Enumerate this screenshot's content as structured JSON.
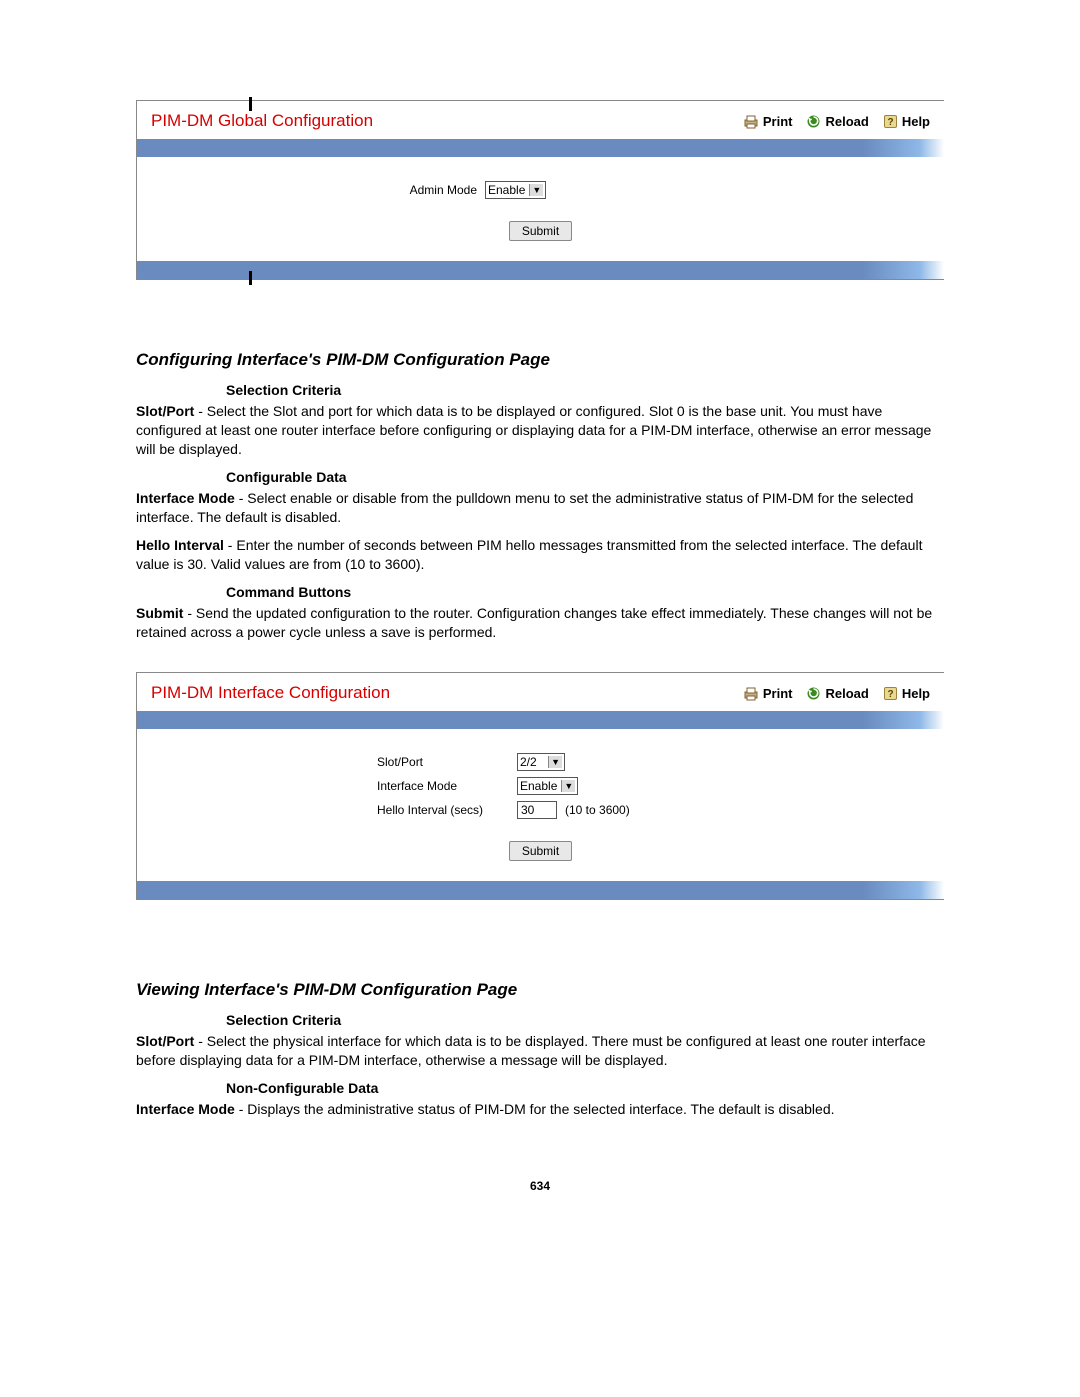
{
  "panel1": {
    "title": "PIM-DM Global Configuration",
    "actions": {
      "print": "Print",
      "reload": "Reload",
      "help": "Help"
    },
    "form": {
      "admin_mode_label": "Admin Mode",
      "admin_mode_value": "Enable"
    },
    "submit": "Submit"
  },
  "section1": {
    "heading": "Configuring Interface's PIM-DM Configuration Page",
    "selection_criteria_label": "Selection Criteria",
    "slot_port_label": "Slot/Port",
    "slot_port_text": " - Select the Slot and port for which data is to be displayed or configured. Slot 0 is the base unit. You must have configured at least one router interface before configuring or displaying data for a PIM-DM interface, otherwise an error message will be displayed.",
    "configurable_data_label": "Configurable Data",
    "interface_mode_label": "Interface Mode",
    "interface_mode_text": " - Select enable or disable from the pulldown menu to set the administrative status of PIM-DM for the selected interface. The default is disabled.",
    "hello_interval_label": "Hello Interval",
    "hello_interval_text": " - Enter the number of seconds between PIM hello messages transmitted from the selected interface. The default value is 30. Valid values are from (10 to 3600).",
    "command_buttons_label": "Command Buttons",
    "submit_label": "Submit",
    "submit_text": " - Send the updated configuration to the router. Configuration changes take effect immediately. These changes will not be retained across a power cycle unless a save is performed."
  },
  "panel2": {
    "title": "PIM-DM Interface Configuration",
    "actions": {
      "print": "Print",
      "reload": "Reload",
      "help": "Help"
    },
    "form": {
      "slot_port_label": "Slot/Port",
      "slot_port_value": "2/2",
      "interface_mode_label": "Interface Mode",
      "interface_mode_value": "Enable",
      "hello_interval_label": "Hello Interval (secs)",
      "hello_interval_value": "30",
      "hello_interval_hint": "(10 to 3600)"
    },
    "submit": "Submit"
  },
  "section2": {
    "heading": "Viewing Interface's PIM-DM Configuration Page",
    "selection_criteria_label": "Selection Criteria",
    "slot_port_label": "Slot/Port",
    "slot_port_text": " - Select the physical interface for which data is to be displayed. There must be configured at least one router interface before displaying data for a PIM-DM interface, otherwise a message will be displayed.",
    "non_configurable_data_label": "Non-Configurable Data",
    "interface_mode_label": "Interface Mode",
    "interface_mode_text": " - Displays the administrative status of PIM-DM for the selected interface. The default is disabled."
  },
  "page_number": "634"
}
